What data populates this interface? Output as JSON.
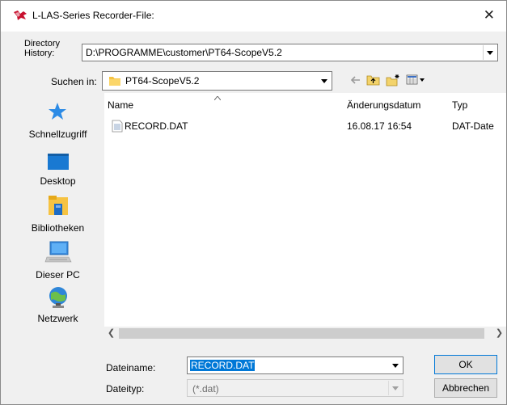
{
  "window": {
    "title": "L-LAS-Series Recorder-File:"
  },
  "directory_history": {
    "label_line1": "Directory",
    "label_line2": "History:",
    "value": "D:\\PROGRAMME\\customer\\PT64-ScopeV5.2"
  },
  "look_in": {
    "label": "Suchen in:",
    "value": "PT64-ScopeV5.2"
  },
  "places": [
    {
      "label": "Schnellzugriff",
      "icon": "star-icon"
    },
    {
      "label": "Desktop",
      "icon": "desktop-icon"
    },
    {
      "label": "Bibliotheken",
      "icon": "libraries-icon"
    },
    {
      "label": "Dieser PC",
      "icon": "computer-icon"
    },
    {
      "label": "Netzwerk",
      "icon": "network-icon"
    }
  ],
  "file_list": {
    "columns": [
      "Name",
      "Änderungsdatum",
      "Typ"
    ],
    "rows": [
      {
        "name": "RECORD.DAT",
        "modified": "16.08.17 16:54",
        "type": "DAT-Date"
      }
    ]
  },
  "filename": {
    "label": "Dateiname:",
    "value": "RECORD.DAT"
  },
  "filetype": {
    "label": "Dateityp:",
    "value": "(*.dat)"
  },
  "buttons": {
    "ok": "OK",
    "cancel": "Abbrechen"
  },
  "colors": {
    "accent": "#0078d7",
    "folder": "#f6c342"
  }
}
